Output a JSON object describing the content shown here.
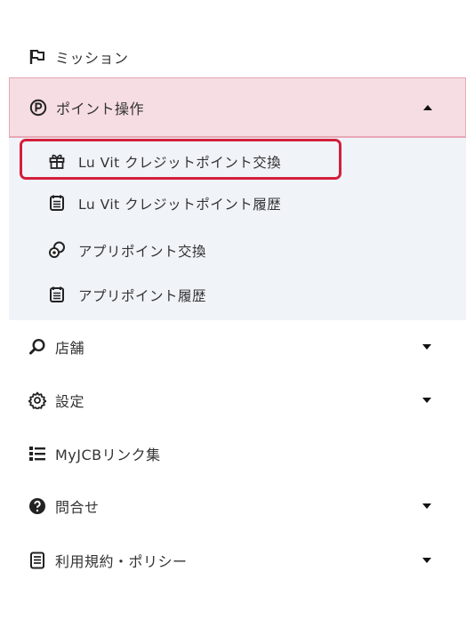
{
  "menu": {
    "mission": {
      "label": "ミッション",
      "icon": "flag-icon"
    },
    "points": {
      "label": "ポイント操作",
      "icon": "p-circle-icon",
      "expanded": true,
      "accent_bg": "#f6dde3",
      "accent_border": "#e7a7b4",
      "subitems": [
        {
          "label": "Lu Vit クレジットポイント交換",
          "icon": "gift-icon",
          "highlighted": true
        },
        {
          "label": "Lu Vit クレジットポイント履歴",
          "icon": "calendar-icon"
        },
        {
          "label": "アプリポイント交換",
          "icon": "coins-icon"
        },
        {
          "label": "アプリポイント履歴",
          "icon": "calendar-icon"
        }
      ]
    },
    "shop": {
      "label": "店舗",
      "icon": "search-icon"
    },
    "settings": {
      "label": "設定",
      "icon": "gear-icon"
    },
    "links": {
      "label": "MyJCBリンク集",
      "icon": "list-icon"
    },
    "contact": {
      "label": "問合せ",
      "icon": "question-circle-icon"
    },
    "terms": {
      "label": "利用規約・ポリシー",
      "icon": "document-icon"
    }
  },
  "colors": {
    "highlight": "#d31f3c",
    "submenu_bg": "#f0f4f9",
    "text": "#333333"
  }
}
